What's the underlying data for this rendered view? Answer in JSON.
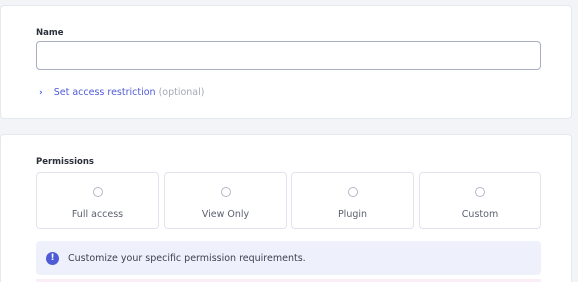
{
  "name_section": {
    "label": "Name",
    "input_value": "",
    "input_placeholder": "",
    "access_link_label": "Set access restriction",
    "access_link_optional": "(optional)"
  },
  "permissions": {
    "label": "Permissions",
    "options": [
      {
        "label": "Full access",
        "selected": false
      },
      {
        "label": "View Only",
        "selected": false
      },
      {
        "label": "Plugin",
        "selected": false
      },
      {
        "label": "Custom",
        "selected": false
      }
    ],
    "info_icon": "exclamation-icon",
    "info_text": "Customize your specific permission requirements."
  },
  "colors": {
    "accent": "#4f5bd5",
    "background": "#f3f4f8",
    "info_bg": "#eef0fb"
  }
}
